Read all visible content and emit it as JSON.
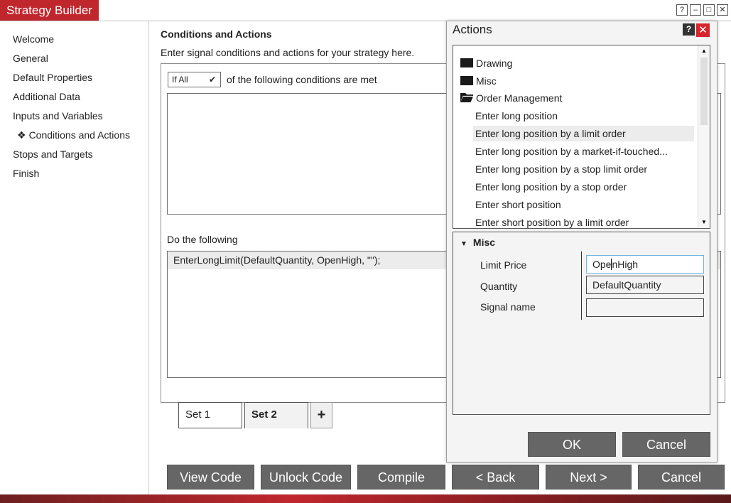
{
  "window": {
    "title": "Strategy Builder",
    "controls": [
      "?",
      "–",
      "□",
      "✕"
    ]
  },
  "nav": {
    "items": [
      {
        "label": "Welcome",
        "active": false
      },
      {
        "label": "General",
        "active": false
      },
      {
        "label": "Default Properties",
        "active": false
      },
      {
        "label": "Additional Data",
        "active": false
      },
      {
        "label": "Inputs and Variables",
        "active": false
      },
      {
        "label": "Conditions and Actions",
        "active": true
      },
      {
        "label": "Stops and Targets",
        "active": false
      },
      {
        "label": "Finish",
        "active": false
      }
    ],
    "active_marker": "❖"
  },
  "main": {
    "heading": "Conditions and Actions",
    "description": "Enter signal conditions and actions for your strategy here.",
    "condition_mode": "If All",
    "condition_text": "of the following conditions are met",
    "do_label": "Do the following",
    "action_line": "EnterLongLimit(DefaultQuantity, OpenHigh, \"\");"
  },
  "sets": {
    "tabs": [
      {
        "label": "Set 1",
        "active": false
      },
      {
        "label": "Set 2",
        "active": true
      }
    ],
    "add_label": "+"
  },
  "buttons": {
    "view_code": "View Code",
    "unlock_code": "Unlock Code",
    "compile": "Compile",
    "back": "< Back",
    "next": "Next >",
    "cancel": "Cancel"
  },
  "actions_dialog": {
    "title": "Actions",
    "help": "?",
    "close": "✕",
    "tree": [
      {
        "label": "Drawing",
        "type": "folder"
      },
      {
        "label": "Misc",
        "type": "folder"
      },
      {
        "label": "Order Management",
        "type": "folder-open"
      },
      {
        "label": "Enter long position",
        "type": "item"
      },
      {
        "label": "Enter long position by a limit order",
        "type": "item",
        "selected": true
      },
      {
        "label": "Enter long position by a market-if-touched...",
        "type": "item"
      },
      {
        "label": "Enter long position by a stop limit order",
        "type": "item"
      },
      {
        "label": "Enter long position by a stop order",
        "type": "item"
      },
      {
        "label": "Enter short position",
        "type": "item"
      },
      {
        "label": "Enter short position by a limit order",
        "type": "item"
      }
    ],
    "properties": {
      "section": "Misc",
      "limit_price_label": "Limit Price",
      "limit_price_value_a": "Ope",
      "limit_price_value_b": "nHigh",
      "quantity_label": "Quantity",
      "quantity_value": "DefaultQuantity",
      "signal_name_label": "Signal name",
      "signal_name_value": ""
    },
    "ok": "OK",
    "cancel": "Cancel"
  },
  "colors": {
    "accent": "#c0272d",
    "button": "#666666"
  }
}
